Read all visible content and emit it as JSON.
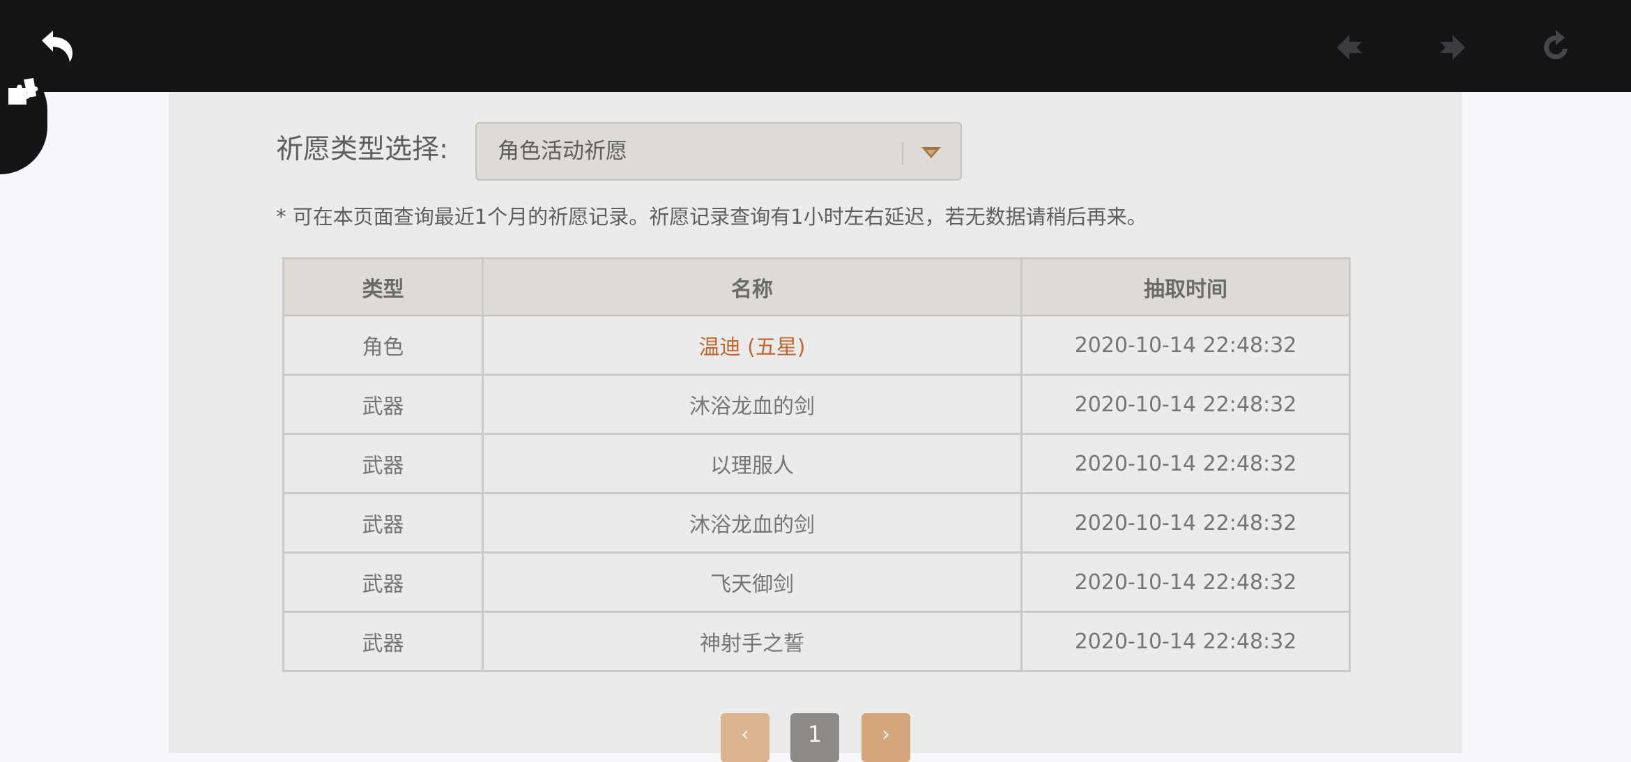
{
  "toolbar": {
    "back_icon": "undo-arrow-icon",
    "prev_icon": "nav-back-icon",
    "next_icon": "nav-forward-icon",
    "refresh_icon": "refresh-icon"
  },
  "side_tool": {
    "icon": "puzzle-icon"
  },
  "filter": {
    "label": "祈愿类型选择:",
    "selected": "角色活动祈愿"
  },
  "notice": "* 可在本页面查询最近1个月的祈愿记录。祈愿记录查询有1小时左右延迟，若无数据请稍后再来。",
  "table": {
    "headers": [
      "类型",
      "名称",
      "抽取时间"
    ],
    "rows": [
      {
        "type": "角色",
        "name": "温迪 (五星)",
        "time": "2020-10-14 22:48:32"
      },
      {
        "type": "武器",
        "name": "沐浴龙血的剑",
        "time": "2020-10-14 22:48:32"
      },
      {
        "type": "武器",
        "name": "以理服人",
        "time": "2020-10-14 22:48:32"
      },
      {
        "type": "武器",
        "name": "沐浴龙血的剑",
        "time": "2020-10-14 22:48:32"
      },
      {
        "type": "武器",
        "name": "飞天御剑",
        "time": "2020-10-14 22:48:32"
      },
      {
        "type": "武器",
        "name": "神射手之誓",
        "time": "2020-10-14 22:48:32"
      }
    ]
  },
  "pagination": {
    "prev": "‹",
    "current": "1",
    "next": "›"
  },
  "colors": {
    "five_star": "#bd6832",
    "pager_accent": "#d3a77b"
  }
}
